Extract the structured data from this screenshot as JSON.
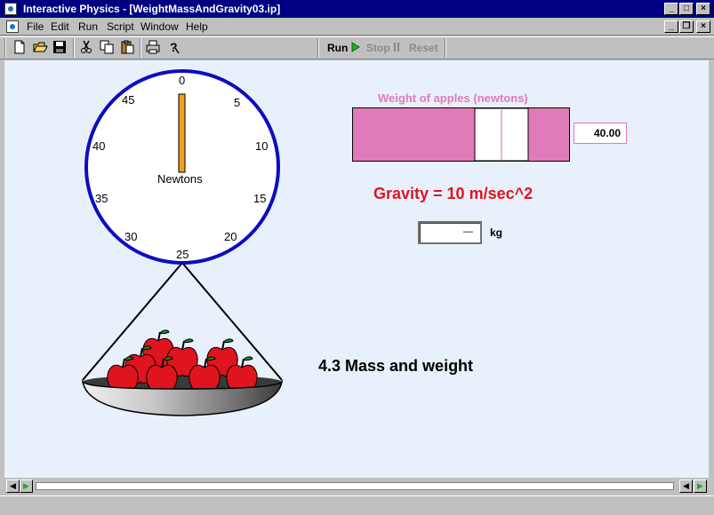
{
  "window": {
    "title": "Interactive Physics - [WeightMassAndGravity03.ip]",
    "caption_buttons": [
      "_",
      "□",
      "×"
    ],
    "doc_buttons": [
      "_",
      "❐",
      "×"
    ]
  },
  "menu": [
    "File",
    "Edit",
    "Run",
    "Script",
    "Window",
    "Help"
  ],
  "toolbar": {
    "icons": [
      "new-file-icon",
      "open-folder-icon",
      "save-icon",
      "cut-icon",
      "copy-icon",
      "paste-icon",
      "print-icon",
      "help-icon"
    ],
    "run_label": "Run",
    "stop_label": "Stop",
    "reset_label": "Reset"
  },
  "scale": {
    "ticks": [
      "0",
      "5",
      "10",
      "15",
      "20",
      "25",
      "30",
      "35",
      "40",
      "45"
    ],
    "unit_label": "Newtons",
    "reading": 0
  },
  "weight_meter": {
    "label": "Weight of apples (newtons)",
    "value": "40.00",
    "level": 0.4,
    "colors": {
      "fill": "#e07bb9",
      "text": "#e07bb9"
    }
  },
  "gravity": {
    "text": "Gravity = 10 m/sec^2",
    "color": "#e0141e"
  },
  "mass": {
    "unit": "kg",
    "value": "—"
  },
  "heading": "4.3 Mass and weight"
}
